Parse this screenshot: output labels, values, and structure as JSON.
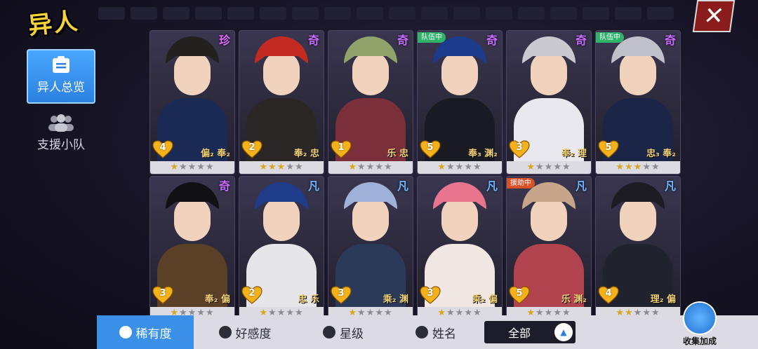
{
  "header": {
    "title": "异人",
    "close_icon": "close-x-icon"
  },
  "sidebar": {
    "items": [
      {
        "label": "异人总览",
        "icon": "clipboard-icon",
        "active": true
      },
      {
        "label": "支援小队",
        "icon": "group-icon",
        "active": false
      }
    ]
  },
  "cards": [
    {
      "rarity": "珍",
      "heart": "4",
      "skills": "偏₂ 奉₂",
      "stars": 1,
      "tag": "",
      "hair": "#22211f",
      "body": "#1b2a55"
    },
    {
      "rarity": "奇",
      "heart": "2",
      "skills": "奉₂ 忠",
      "stars": 3,
      "tag": "",
      "hair": "#c32a22",
      "body": "#2a2626"
    },
    {
      "rarity": "奇",
      "heart": "1",
      "skills": "乐 忠",
      "stars": 1,
      "tag": "",
      "hair": "#8fa36b",
      "body": "#7a2f3a"
    },
    {
      "rarity": "奇",
      "heart": "5",
      "skills": "奉₃ 渊₂",
      "stars": 1,
      "tag": "队伍中",
      "hair": "#1d3b8c",
      "body": "#1a1a22"
    },
    {
      "rarity": "奇",
      "heart": "3",
      "skills": "奉₂ 理",
      "stars": 1,
      "tag": "",
      "hair": "#c9c9cf",
      "body": "#e8e8ee"
    },
    {
      "rarity": "奇",
      "heart": "5",
      "skills": "忠₃ 奉₂",
      "stars": 3,
      "tag": "队伍中",
      "hair": "#bfc0c8",
      "body": "#1b2548"
    },
    {
      "rarity": "奇",
      "heart": "3",
      "skills": "奉₂ 偏",
      "stars": 1,
      "tag": "",
      "hair": "#111114",
      "body": "#5a4026"
    },
    {
      "rarity": "凡",
      "heart": "2",
      "skills": "忠 乐",
      "stars": 1,
      "tag": "",
      "hair": "#1f3c8a",
      "body": "#e6e6ea"
    },
    {
      "rarity": "凡",
      "heart": "3",
      "skills": "乘₂ 渊",
      "stars": 1,
      "tag": "",
      "hair": "#9fb1d6",
      "body": "#2b3a58"
    },
    {
      "rarity": "凡",
      "heart": "3",
      "skills": "乘₂ 偏",
      "stars": 1,
      "tag": "",
      "hair": "#e8748e",
      "body": "#f1e7e2"
    },
    {
      "rarity": "凡",
      "heart": "5",
      "skills": "乐 渊₂",
      "stars": 1,
      "tag": "援助中",
      "hair": "#c7a58a",
      "body": "#b0434e"
    },
    {
      "rarity": "凡",
      "heart": "4",
      "skills": "理₂ 偏",
      "stars": 2,
      "tag": "",
      "hair": "#1c1c22",
      "body": "#20232e"
    }
  ],
  "bottom": {
    "tabs": [
      {
        "label": "稀有度",
        "icon": "rarity-icon",
        "active": true
      },
      {
        "label": "好感度",
        "icon": "heart-icon",
        "active": false
      },
      {
        "label": "星级",
        "icon": "star-icon",
        "active": false
      },
      {
        "label": "姓名",
        "icon": "name-icon",
        "active": false
      }
    ],
    "filter_value": "全部",
    "filter_icon": "triangle-up-icon",
    "collect_label": "收集加成",
    "collect_icon": "cube-icon"
  },
  "colors": {
    "accent": "#3a8fe6",
    "star_gold": "#d9a520",
    "title_gold": "#f7d13a"
  }
}
